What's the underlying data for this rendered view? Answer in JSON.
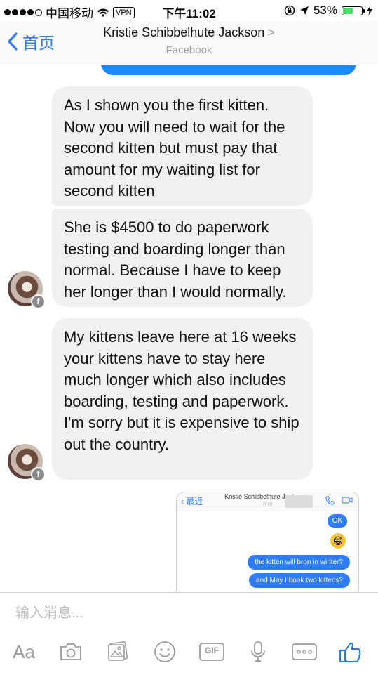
{
  "status_bar": {
    "carrier": "中国移动",
    "vpn": "VPN",
    "time": "下午11:02",
    "battery": "53%",
    "battery_level": 0.53
  },
  "nav": {
    "back_label": "首页",
    "title": "Kristie Schibbelhute Jackson",
    "title_chevron": ">",
    "subtitle": "Facebook"
  },
  "messages": [
    {
      "text": "As I shown you the first kitten. Now you will need to wait for the second kitten but must pay that amount for my waiting list for second kitten"
    },
    {
      "text": "She is $4500 to do paperwork testing and boarding longer than normal. Because I have to keep her longer than I would normally."
    },
    {
      "text": "My kittens leave here at 16 weeks your kittens have to stay here much longer which also includes boarding, testing and paperwork. I'm sorry but it is expensive to ship out the country."
    }
  ],
  "avatar_badge": "f",
  "embedded_screenshot": {
    "back_label": "最近",
    "title": "Kristie Schibbelhute Jackson >",
    "subtitle": "在线",
    "ok_label": "OK",
    "emoji": "😄",
    "messages": [
      "the kitten will bron in winter?",
      "and May I book two kittens?"
    ]
  },
  "composer": {
    "placeholder": "输入消息...",
    "aa_label": "Aa",
    "gif_label": "GIF",
    "like_color": "#1f7bf2",
    "accent_color": "#2f7cf6",
    "icons": [
      "text-format-icon",
      "camera-icon",
      "gallery-icon",
      "sticker-icon",
      "gif-icon",
      "microphone-icon",
      "more-icon",
      "thumbs-up-icon"
    ]
  }
}
